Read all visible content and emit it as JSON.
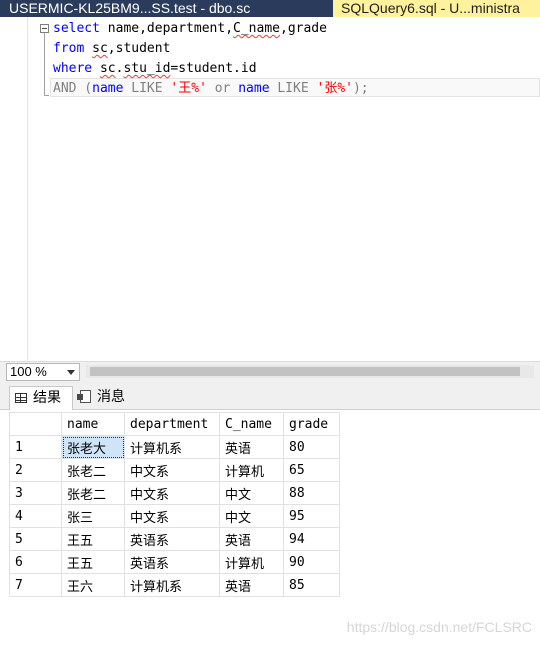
{
  "tabs": {
    "left": "USERMIC-KL25BM9...SS.test - dbo.sc",
    "right": "SQLQuery6.sql - U...ministra"
  },
  "editor": {
    "lines": [
      [
        "select",
        " name,department,",
        "C_name",
        ",grade"
      ],
      [
        "from",
        " ",
        "sc",
        ",student"
      ],
      [
        "where",
        " ",
        "sc",
        ".",
        "stu_id",
        "=student.id"
      ],
      [
        "AND (",
        "name",
        " LIKE ",
        "'王%'",
        " or ",
        "name",
        " LIKE ",
        "'张%'",
        ");"
      ]
    ]
  },
  "zoom": {
    "value": "100 %"
  },
  "results": {
    "tabs": {
      "results": "结果",
      "messages": "消息"
    },
    "columns": [
      "name",
      "department",
      "C_name",
      "grade"
    ],
    "rows": [
      {
        "n": "1",
        "name": "张老大",
        "department": "计算机系",
        "C_name": "英语",
        "grade": "80"
      },
      {
        "n": "2",
        "name": "张老二",
        "department": "中文系",
        "C_name": "计算机",
        "grade": "65"
      },
      {
        "n": "3",
        "name": "张老二",
        "department": "中文系",
        "C_name": "中文",
        "grade": "88"
      },
      {
        "n": "4",
        "name": "张三",
        "department": "中文系",
        "C_name": "中文",
        "grade": "95"
      },
      {
        "n": "5",
        "name": "王五",
        "department": "英语系",
        "C_name": "英语",
        "grade": "94"
      },
      {
        "n": "6",
        "name": "王五",
        "department": "英语系",
        "C_name": "计算机",
        "grade": "90"
      },
      {
        "n": "7",
        "name": "王六",
        "department": "计算机系",
        "C_name": "英语",
        "grade": "85"
      }
    ]
  },
  "watermark": "https://blog.csdn.net/FCLSRC"
}
